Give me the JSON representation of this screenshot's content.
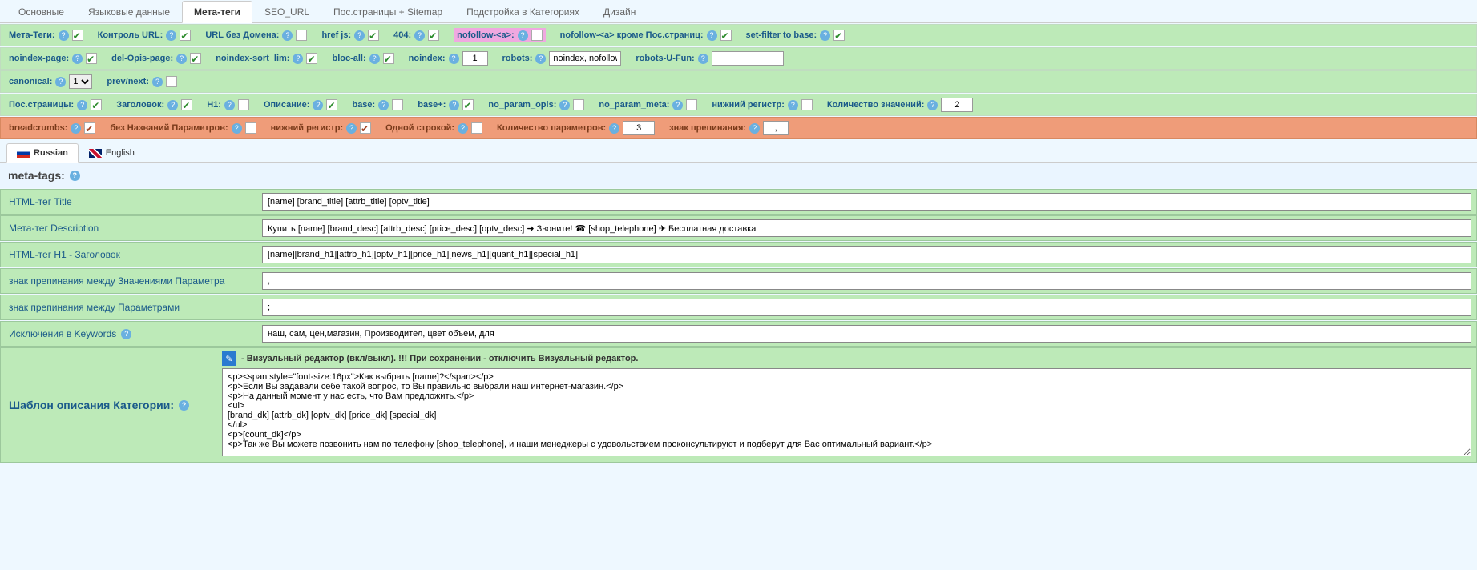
{
  "tabs": {
    "main": [
      "Основные",
      "Языковые данные",
      "Мета-теги",
      "SEO_URL",
      "Пос.страницы + Sitemap",
      "Подстройка в Категориях",
      "Дизайн"
    ],
    "active": 2
  },
  "row1": {
    "meta_tags": "Мета-Теги:",
    "control_url": "Контроль URL:",
    "url_no_domain": "URL без Домена:",
    "href_js": "href js:",
    "err404": "404:",
    "nofollow_a": "nofollow-<a>:",
    "nofollow_a_except": "nofollow-<a> кроме Пос.страниц:",
    "set_filter": "set-filter to base:"
  },
  "row2": {
    "noindex_page": "noindex-page:",
    "del_opis": "del-Opis-page:",
    "noindex_sort": "noindex-sort_lim:",
    "bloc_all": "bloc-all:",
    "noindex": "noindex:",
    "noindex_val": "1",
    "robots": "robots:",
    "robots_val": "noindex, nofollow",
    "robots_u_fun": "robots-U-Fun:",
    "robots_u_fun_val": ""
  },
  "row3": {
    "canonical": "canonical:",
    "canonical_val": "1",
    "prevnext": "prev/next:"
  },
  "row4": {
    "pos_pages": "Пос.страницы:",
    "header": "Заголовок:",
    "h1": "H1:",
    "description": "Описание:",
    "base": "base:",
    "base_plus": "base+:",
    "no_param_opis": "no_param_opis:",
    "no_param_meta": "no_param_meta:",
    "lowercase": "нижний регистр:",
    "count_values": "Количество значений:",
    "count_values_val": "2"
  },
  "row5": {
    "breadcrumbs": "breadcrumbs:",
    "no_param_names": "без Названий Параметров:",
    "lowercase": "нижний регистр:",
    "one_line": "Одной строкой:",
    "count_params": "Количество параметров:",
    "count_params_val": "3",
    "punctuation": "знак препинания:",
    "punctuation_val": ","
  },
  "lang_tabs": {
    "ru": "Russian",
    "en": "English",
    "active": 0
  },
  "section_meta": "meta-tags:",
  "fields": {
    "title_label": "HTML-тег Title",
    "title_val": "[name] [brand_title] [attrb_title] [optv_title]",
    "desc_label": "Мета-тег Description",
    "desc_val": "Купить [name] [brand_desc] [attrb_desc] [price_desc] [optv_desc] ➜ Звоните! ☎ [shop_telephone] ✈ Бесплатная доставка",
    "h1_label": "HTML-тег H1 - Заголовок",
    "h1_val": "[name][brand_h1][attrb_h1][optv_h1][price_h1][news_h1][quant_h1][special_h1]",
    "punct_values_label": "знак препинания между Значениями Параметра",
    "punct_values_val": ",",
    "punct_params_label": "знак препинания между Параметрами",
    "punct_params_val": ";",
    "excl_keywords_label": "Исключения в Keywords",
    "excl_keywords_val": "наш, сам, цен,магазин, Производител, цвет объем, для"
  },
  "desc_template": {
    "label": "Шаблон описания Категории:",
    "toggle": "- Визуальный редактор (вкл/выкл). !!! При сохранении - отключить Визуальный редактор.",
    "text": "<p><span style=\"font-size:16px\">Как выбрать [name]?</span></p>\n<p>Если Вы задавали себе такой вопрос, то Вы правильно выбрали наш интернет-магазин.</p>\n<p>На данный момент у нас есть, что Вам предложить.</p>\n<ul>\n[brand_dk] [attrb_dk] [optv_dk] [price_dk] [special_dk]\n</ul>\n<p>[count_dk]</p>\n<p>Так же Вы можете позвонить нам по телефону [shop_telephone], и наши менеджеры с удовольствием проконсультируют и подберут для Вас оптимальный вариант.</p>"
  }
}
